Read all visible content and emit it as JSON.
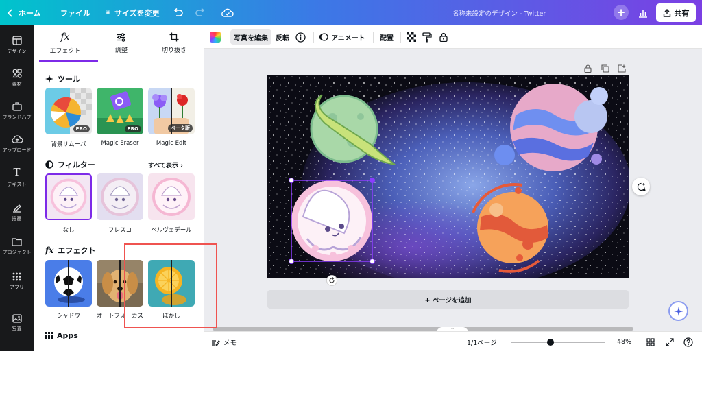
{
  "topbar": {
    "home": "ホーム",
    "file": "ファイル",
    "resize": "サイズを変更",
    "doc_title": "名称未設定のデザイン - Twitter",
    "plus": "+",
    "share": "共有"
  },
  "rail": {
    "items": [
      {
        "label": "デザイン",
        "icon": "layout-icon"
      },
      {
        "label": "素材",
        "icon": "shapes-icon"
      },
      {
        "label": "ブランドハブ",
        "icon": "brand-icon"
      },
      {
        "label": "アップロード",
        "icon": "upload-cloud-icon"
      },
      {
        "label": "テキスト",
        "icon": "text-icon"
      },
      {
        "label": "描画",
        "icon": "draw-icon"
      },
      {
        "label": "プロジェクト",
        "icon": "folder-icon"
      },
      {
        "label": "アプリ",
        "icon": "apps-grid-icon"
      },
      {
        "label": "写真",
        "icon": "photo-icon"
      }
    ]
  },
  "panel": {
    "tabs": [
      {
        "label": "エフェクト",
        "glyph": "fx"
      },
      {
        "label": "調整",
        "glyph": "sliders"
      },
      {
        "label": "切り抜き",
        "glyph": "crop"
      }
    ],
    "tools": {
      "title": "ツール",
      "items": [
        {
          "label": "背景リムーバ",
          "badge": "PRO"
        },
        {
          "label": "Magic Eraser",
          "badge": "PRO"
        },
        {
          "label": "Magic Edit",
          "badge": "ベータ版"
        }
      ]
    },
    "filters": {
      "title": "フィルター",
      "see_all": "すべて表示",
      "items": [
        {
          "label": "なし"
        },
        {
          "label": "フレスコ"
        },
        {
          "label": "ベルヴェデール"
        }
      ]
    },
    "effects": {
      "title": "エフェクト",
      "items": [
        {
          "label": "シャドウ"
        },
        {
          "label": "オートフォーカス"
        },
        {
          "label": "ぼかし"
        }
      ]
    },
    "apps": {
      "title": "Apps"
    }
  },
  "toolbar": {
    "edit_photo": "写真を編集",
    "flip": "反転",
    "animate": "アニメート",
    "position": "配置"
  },
  "editor": {
    "add_page": "+ ページを追加"
  },
  "footer": {
    "notes": "メモ",
    "page_indicator": "1/1ページ",
    "zoom": "48%",
    "zoom_level": 0.42
  },
  "colors": {
    "accent": "#7d2ae8",
    "highlight": "#ef5350",
    "rail_bg": "#18191b",
    "canvas_bg": "#0b0b14"
  }
}
